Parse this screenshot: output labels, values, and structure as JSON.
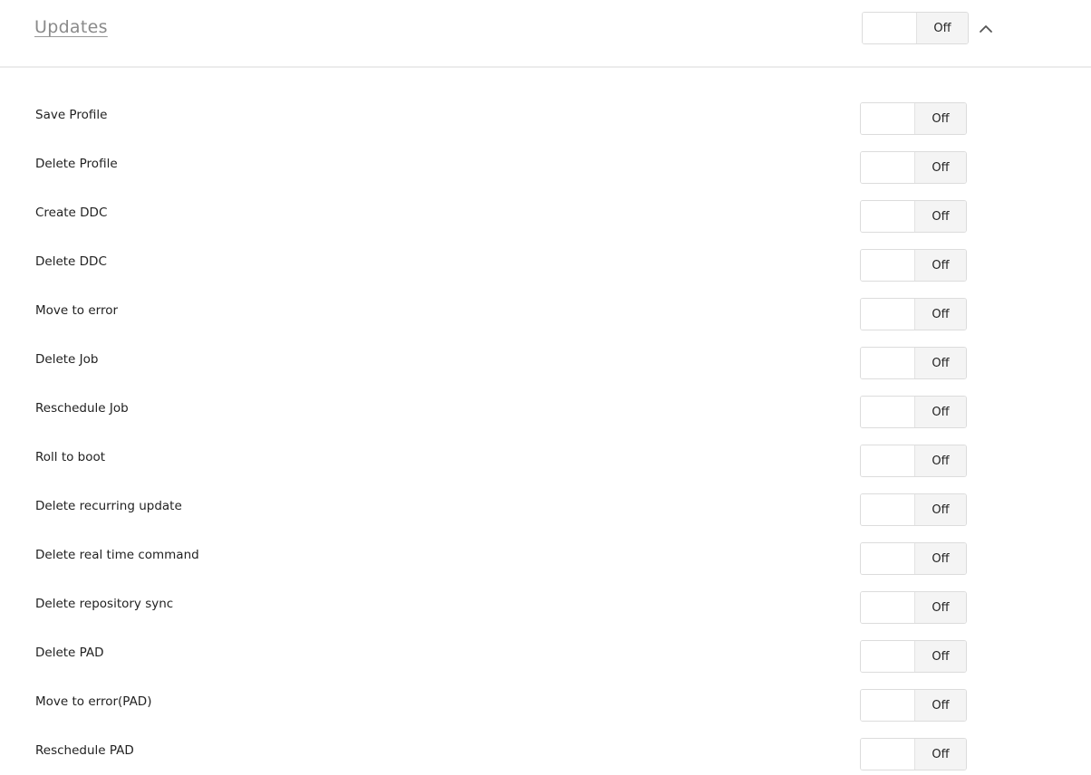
{
  "section": {
    "title": "Updates",
    "toggle_state": "Off"
  },
  "settings": [
    {
      "label": "Save Profile",
      "state": "Off"
    },
    {
      "label": "Delete Profile",
      "state": "Off"
    },
    {
      "label": "Create DDC",
      "state": "Off"
    },
    {
      "label": "Delete DDC",
      "state": "Off"
    },
    {
      "label": "Move to error",
      "state": "Off"
    },
    {
      "label": "Delete Job",
      "state": "Off"
    },
    {
      "label": "Reschedule Job",
      "state": "Off"
    },
    {
      "label": "Roll to boot",
      "state": "Off"
    },
    {
      "label": "Delete recurring update",
      "state": "Off"
    },
    {
      "label": "Delete real time command",
      "state": "Off"
    },
    {
      "label": "Delete repository sync",
      "state": "Off"
    },
    {
      "label": "Delete PAD",
      "state": "Off"
    },
    {
      "label": "Move to error(PAD)",
      "state": "Off"
    },
    {
      "label": "Reschedule PAD",
      "state": "Off"
    }
  ],
  "icons": {
    "collapse": "chevron-up-icon"
  },
  "colors": {
    "title": "#8a8a8a",
    "toggle_off_bg": "#f4f4f4",
    "toggle_border": "#dcdcdc",
    "divider": "#ececec"
  }
}
